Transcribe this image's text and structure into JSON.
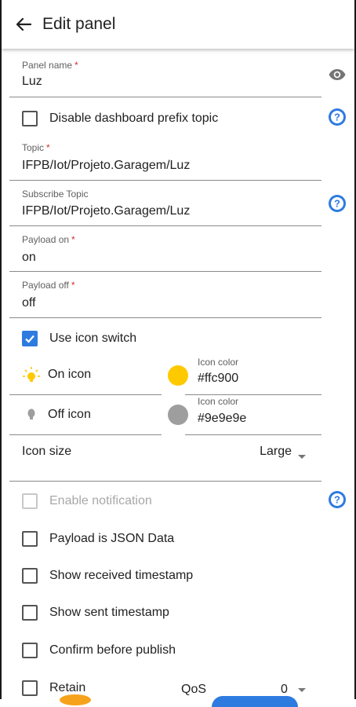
{
  "appbar": {
    "title": "Edit panel"
  },
  "panel_name": {
    "label": "Panel name",
    "required": "*",
    "value": "Luz"
  },
  "disable_prefix": {
    "label": "Disable dashboard prefix topic",
    "checked": false
  },
  "topic": {
    "label": "Topic",
    "required": "*",
    "value": "IFPB/Iot/Projeto.Garagem/Luz"
  },
  "subscribe_topic": {
    "label": "Subscribe Topic",
    "value": "IFPB/Iot/Projeto.Garagem/Luz"
  },
  "payload_on": {
    "label": "Payload on",
    "required": "*",
    "value": "on"
  },
  "payload_off": {
    "label": "Payload off",
    "required": "*",
    "value": "off"
  },
  "use_icon_switch": {
    "label": "Use icon switch",
    "checked": true
  },
  "on_icon": {
    "label": "On icon",
    "icon": "lightbulb-on-icon",
    "color_label": "Icon color",
    "color_value": "#ffc900",
    "color": "#ffc900"
  },
  "off_icon": {
    "label": "Off icon",
    "icon": "lightbulb-off-icon",
    "color_label": "Icon color",
    "color_value": "#9e9e9e",
    "color": "#9e9e9e"
  },
  "icon_size": {
    "label": "Icon size",
    "value": "Large"
  },
  "enable_notification": {
    "label": "Enable notification",
    "checked": false,
    "disabled": true
  },
  "payload_json": {
    "label": "Payload is JSON Data",
    "checked": false
  },
  "show_received": {
    "label": "Show received timestamp",
    "checked": false
  },
  "show_sent": {
    "label": "Show sent timestamp",
    "checked": false
  },
  "confirm_publish": {
    "label": "Confirm before publish",
    "checked": false
  },
  "retain": {
    "label": "Retain",
    "checked": false
  },
  "qos": {
    "label": "QoS",
    "value": "0"
  },
  "colors": {
    "accent": "#2e7be0",
    "help": "#2e7be0",
    "required": "#d32f2f"
  }
}
